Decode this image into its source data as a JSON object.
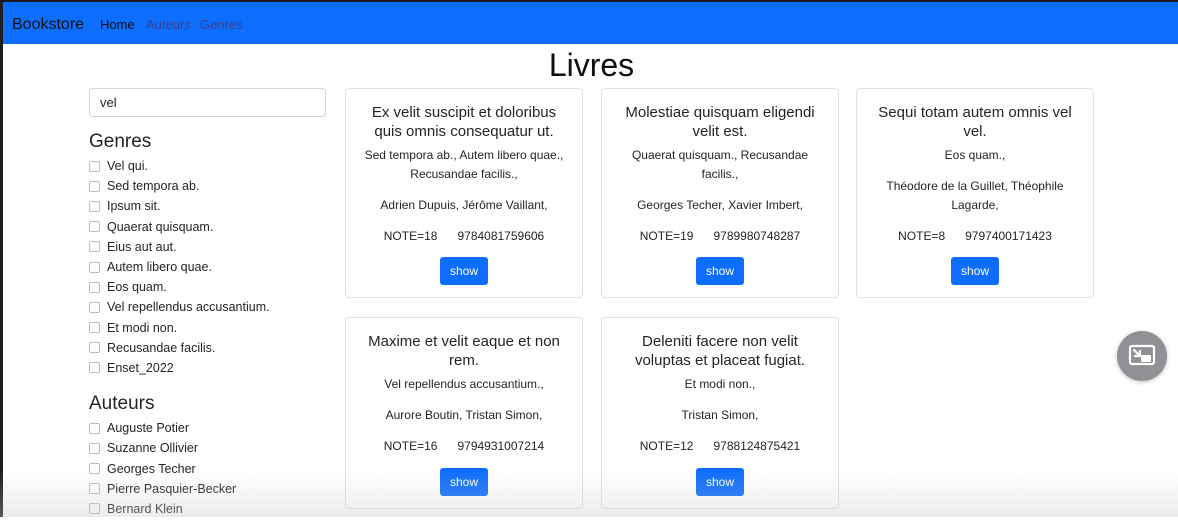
{
  "navbar": {
    "brand": "Bookstore",
    "links": [
      {
        "label": "Home",
        "active": true
      },
      {
        "label": "Auteurs",
        "active": false
      },
      {
        "label": "Genres",
        "active": false
      }
    ],
    "color": "#0d6efd"
  },
  "page_title": "Livres",
  "search": {
    "value": "vel"
  },
  "sidebar": {
    "genres_title": "Genres",
    "genres": [
      "Vel qui.",
      "Sed tempora ab.",
      "Ipsum sit.",
      "Quaerat quisquam.",
      "Eius aut aut.",
      "Autem libero quae.",
      "Eos quam.",
      "Vel repellendus accusantium.",
      "Et modi non.",
      "Recusandae facilis.",
      "Enset_2022"
    ],
    "authors_title": "Auteurs",
    "authors": [
      "Auguste Potier",
      "Suzanne Ollivier",
      "Georges Techer",
      "Pierre Pasquier-Becker",
      "Bernard Klein"
    ]
  },
  "books": [
    {
      "title": "Ex velit suscipit et doloribus quis omnis consequatur ut.",
      "genres": "Sed tempora ab., Autem libero quae., Recusandae facilis.,",
      "authors": "Adrien Dupuis, Jérôme Vaillant,",
      "note": "NOTE=18",
      "isbn": "9784081759606",
      "button": "show"
    },
    {
      "title": "Molestiae quisquam eligendi velit est.",
      "genres": "Quaerat quisquam., Recusandae facilis.,",
      "authors": "Georges Techer, Xavier Imbert,",
      "note": "NOTE=19",
      "isbn": "9789980748287",
      "button": "show"
    },
    {
      "title": "Sequi totam autem omnis vel vel.",
      "genres": "Eos quam.,",
      "authors": "Théodore de la Guillet, Théophile Lagarde,",
      "note": "NOTE=8",
      "isbn": "9797400171423",
      "button": "show"
    },
    {
      "title": "Maxime et velit eaque et non rem.",
      "genres": "Vel repellendus accusantium.,",
      "authors": "Aurore Boutin, Tristan Simon,",
      "note": "NOTE=16",
      "isbn": "9794931007214",
      "button": "show"
    },
    {
      "title": "Deleniti facere non velit voluptas et placeat fugiat.",
      "genres": "Et modi non.,",
      "authors": "Tristan Simon,",
      "note": "NOTE=12",
      "isbn": "9788124875421",
      "button": "show"
    }
  ],
  "icons": {
    "pip": "exit-picture-in-picture-icon"
  }
}
